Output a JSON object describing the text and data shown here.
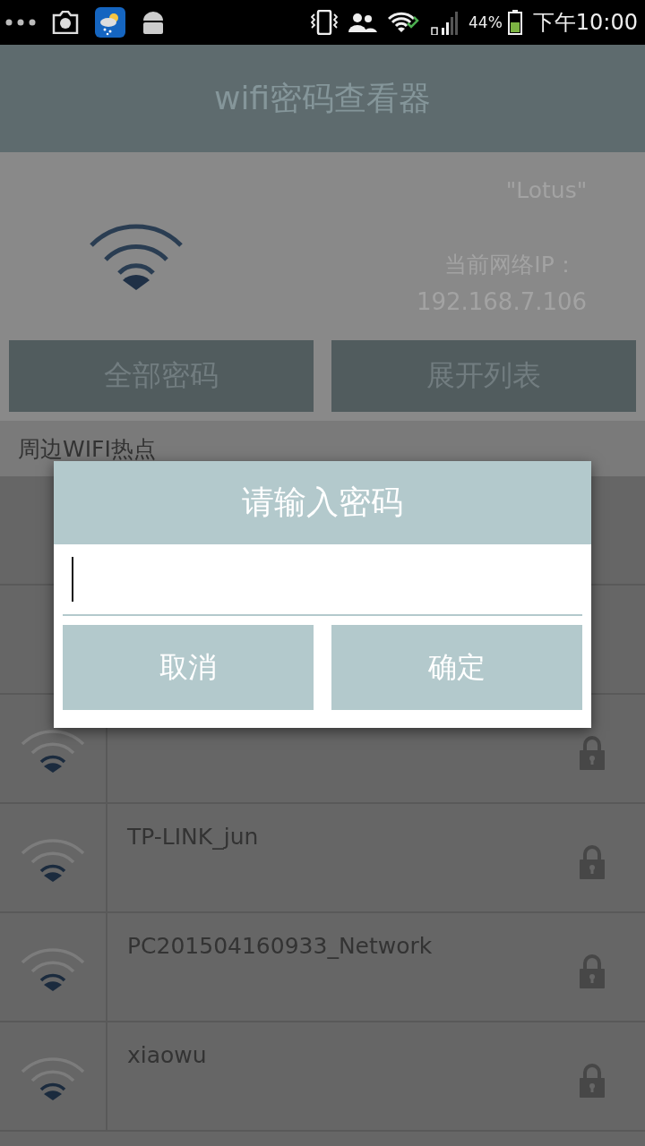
{
  "status_bar": {
    "battery": "44%",
    "time": "下午10:00"
  },
  "app_bar": {
    "title": "wifi密码查看器"
  },
  "current": {
    "ssid": "\"Lotus\"",
    "ip_label": "当前网络IP：",
    "ip": "192.168.7.106"
  },
  "buttons": [
    "全部密码",
    "展开列表"
  ],
  "section": {
    "title": "周边WIFI热点"
  },
  "networks": [
    {
      "locked": true
    },
    {
      "name": "TP-LINK_jun",
      "locked": true
    },
    {
      "name": "PC201504160933_Network",
      "locked": true
    },
    {
      "name": "xiaowu",
      "locked": true
    }
  ],
  "dialog": {
    "title": "请输入密码",
    "buttons": [
      "取消",
      "确定"
    ]
  }
}
